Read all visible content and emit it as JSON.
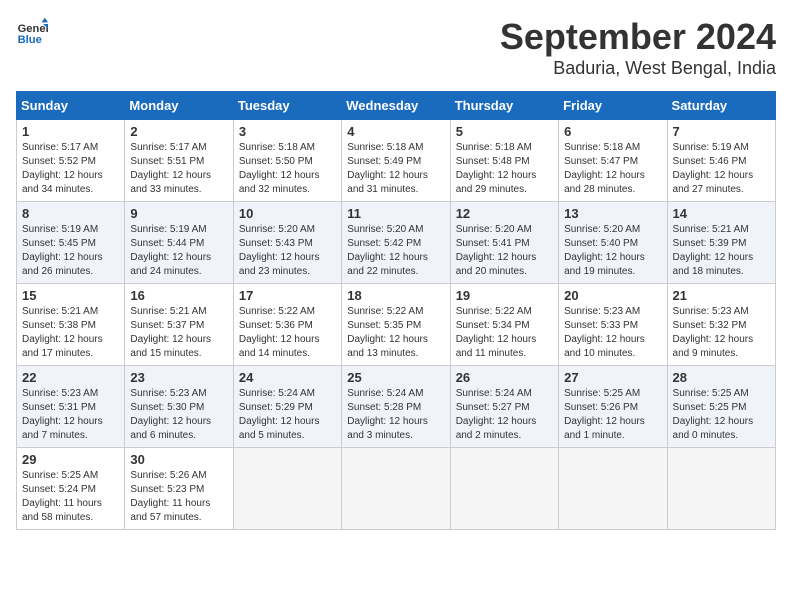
{
  "header": {
    "logo_line1": "General",
    "logo_line2": "Blue",
    "month_title": "September 2024",
    "location": "Baduria, West Bengal, India"
  },
  "weekdays": [
    "Sunday",
    "Monday",
    "Tuesday",
    "Wednesday",
    "Thursday",
    "Friday",
    "Saturday"
  ],
  "weeks": [
    [
      {
        "day": "1",
        "sunrise": "5:17 AM",
        "sunset": "5:52 PM",
        "daylight": "12 hours and 34 minutes."
      },
      {
        "day": "2",
        "sunrise": "5:17 AM",
        "sunset": "5:51 PM",
        "daylight": "12 hours and 33 minutes."
      },
      {
        "day": "3",
        "sunrise": "5:18 AM",
        "sunset": "5:50 PM",
        "daylight": "12 hours and 32 minutes."
      },
      {
        "day": "4",
        "sunrise": "5:18 AM",
        "sunset": "5:49 PM",
        "daylight": "12 hours and 31 minutes."
      },
      {
        "day": "5",
        "sunrise": "5:18 AM",
        "sunset": "5:48 PM",
        "daylight": "12 hours and 29 minutes."
      },
      {
        "day": "6",
        "sunrise": "5:18 AM",
        "sunset": "5:47 PM",
        "daylight": "12 hours and 28 minutes."
      },
      {
        "day": "7",
        "sunrise": "5:19 AM",
        "sunset": "5:46 PM",
        "daylight": "12 hours and 27 minutes."
      }
    ],
    [
      {
        "day": "8",
        "sunrise": "5:19 AM",
        "sunset": "5:45 PM",
        "daylight": "12 hours and 26 minutes."
      },
      {
        "day": "9",
        "sunrise": "5:19 AM",
        "sunset": "5:44 PM",
        "daylight": "12 hours and 24 minutes."
      },
      {
        "day": "10",
        "sunrise": "5:20 AM",
        "sunset": "5:43 PM",
        "daylight": "12 hours and 23 minutes."
      },
      {
        "day": "11",
        "sunrise": "5:20 AM",
        "sunset": "5:42 PM",
        "daylight": "12 hours and 22 minutes."
      },
      {
        "day": "12",
        "sunrise": "5:20 AM",
        "sunset": "5:41 PM",
        "daylight": "12 hours and 20 minutes."
      },
      {
        "day": "13",
        "sunrise": "5:20 AM",
        "sunset": "5:40 PM",
        "daylight": "12 hours and 19 minutes."
      },
      {
        "day": "14",
        "sunrise": "5:21 AM",
        "sunset": "5:39 PM",
        "daylight": "12 hours and 18 minutes."
      }
    ],
    [
      {
        "day": "15",
        "sunrise": "5:21 AM",
        "sunset": "5:38 PM",
        "daylight": "12 hours and 17 minutes."
      },
      {
        "day": "16",
        "sunrise": "5:21 AM",
        "sunset": "5:37 PM",
        "daylight": "12 hours and 15 minutes."
      },
      {
        "day": "17",
        "sunrise": "5:22 AM",
        "sunset": "5:36 PM",
        "daylight": "12 hours and 14 minutes."
      },
      {
        "day": "18",
        "sunrise": "5:22 AM",
        "sunset": "5:35 PM",
        "daylight": "12 hours and 13 minutes."
      },
      {
        "day": "19",
        "sunrise": "5:22 AM",
        "sunset": "5:34 PM",
        "daylight": "12 hours and 11 minutes."
      },
      {
        "day": "20",
        "sunrise": "5:23 AM",
        "sunset": "5:33 PM",
        "daylight": "12 hours and 10 minutes."
      },
      {
        "day": "21",
        "sunrise": "5:23 AM",
        "sunset": "5:32 PM",
        "daylight": "12 hours and 9 minutes."
      }
    ],
    [
      {
        "day": "22",
        "sunrise": "5:23 AM",
        "sunset": "5:31 PM",
        "daylight": "12 hours and 7 minutes."
      },
      {
        "day": "23",
        "sunrise": "5:23 AM",
        "sunset": "5:30 PM",
        "daylight": "12 hours and 6 minutes."
      },
      {
        "day": "24",
        "sunrise": "5:24 AM",
        "sunset": "5:29 PM",
        "daylight": "12 hours and 5 minutes."
      },
      {
        "day": "25",
        "sunrise": "5:24 AM",
        "sunset": "5:28 PM",
        "daylight": "12 hours and 3 minutes."
      },
      {
        "day": "26",
        "sunrise": "5:24 AM",
        "sunset": "5:27 PM",
        "daylight": "12 hours and 2 minutes."
      },
      {
        "day": "27",
        "sunrise": "5:25 AM",
        "sunset": "5:26 PM",
        "daylight": "12 hours and 1 minute."
      },
      {
        "day": "28",
        "sunrise": "5:25 AM",
        "sunset": "5:25 PM",
        "daylight": "12 hours and 0 minutes."
      }
    ],
    [
      {
        "day": "29",
        "sunrise": "5:25 AM",
        "sunset": "5:24 PM",
        "daylight": "11 hours and 58 minutes."
      },
      {
        "day": "30",
        "sunrise": "5:26 AM",
        "sunset": "5:23 PM",
        "daylight": "11 hours and 57 minutes."
      },
      null,
      null,
      null,
      null,
      null
    ]
  ]
}
